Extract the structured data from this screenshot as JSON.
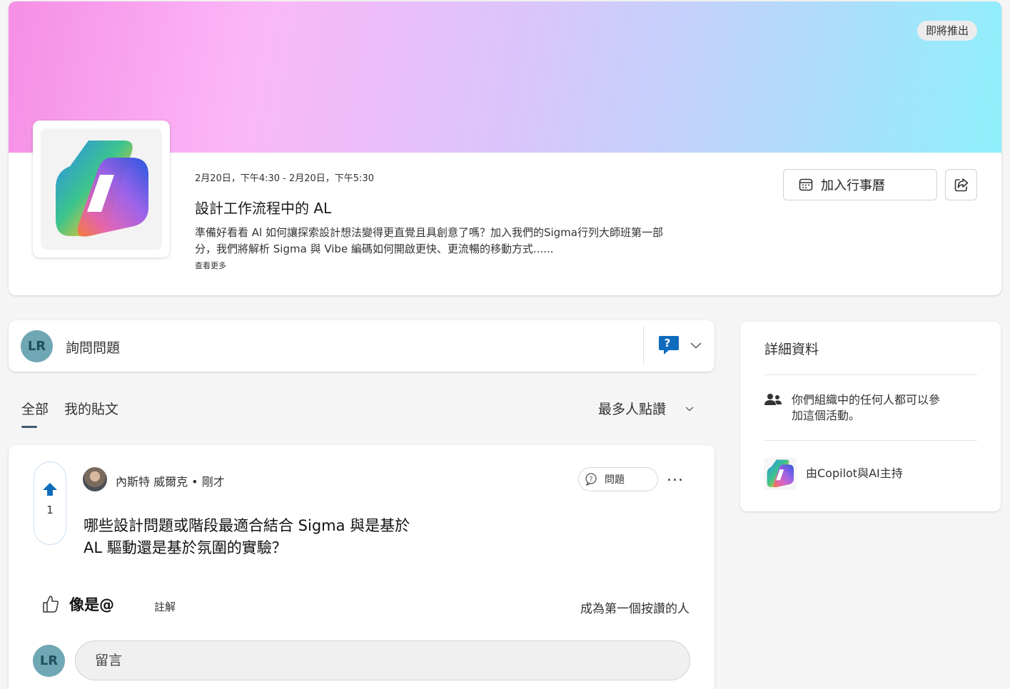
{
  "event": {
    "badge": "即將推出",
    "time": "2月20日，下午4:30 - 2月20日，下午5:30",
    "title": "設計工作流程中的 AL",
    "description": "準備好看看 Al 如何讓探索設計想法變得更直覺且具創意了嗎？加入我們的Sigma行列大師班第一部分，我們將解析 Sigma 與 Vibe 編碼如何開啟更快、更流暢的移動方式......",
    "see_more": "查看更多",
    "add_calendar": "加入行事曆",
    "logo_icon": "copilot-logo-icon",
    "share_icon": "share-icon"
  },
  "ask": {
    "avatar_initials": "LR",
    "label": "詢問問題",
    "type_icon": "question-chat-icon"
  },
  "tabs": {
    "all": "全部",
    "mine": "我的貼文"
  },
  "sort": {
    "selected": "最多人點讚"
  },
  "post": {
    "upvote_count": "1",
    "author": "內斯特 威爾克 • 剛才",
    "type_badge": "問題",
    "more": "...",
    "title": "哪些設計問題或階段最適合結合 Sigma 與是基於 AL 驅動還是基於氛圍的實驗？",
    "like_label": "像是@",
    "comment_link": "註解",
    "first_like": "成為第一個按讚的人",
    "comment_placeholder": "留言",
    "my_initials": "LR"
  },
  "details": {
    "title": "詳細資料",
    "audience": "你們組織中的任何人都可以參加這個活動。",
    "host": "由Copilot與AI主持"
  },
  "colors": {
    "accent": "#0f6cbd",
    "avatar_bg": "#6fa7b4",
    "avatar_text": "#1f4f5c",
    "tab_underline": "#3d5a73"
  }
}
